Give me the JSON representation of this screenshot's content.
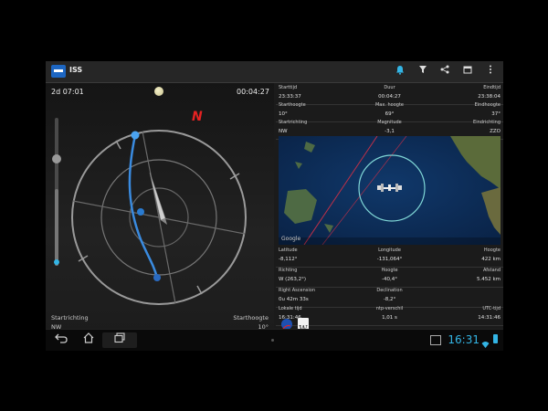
{
  "app": {
    "title": "ISS"
  },
  "actionbar": {
    "icons": [
      "bell-icon",
      "filter-icon",
      "share-icon",
      "calendar-icon",
      "overflow-menu-icon"
    ]
  },
  "left": {
    "countdown": "2d 07:01",
    "duration": "00:04:27",
    "compass_letter": "N",
    "start_dir_label": "Startrichting",
    "start_dir_value": "NW",
    "start_height_label": "Starthoogte",
    "start_height_value": "10°"
  },
  "details": {
    "row1": {
      "l1": "Starttijd",
      "v1": "23:33:37",
      "l2": "Duur",
      "v2": "00:04:27",
      "l3": "Eindtijd",
      "v3": "23:38:04"
    },
    "row2": {
      "l1": "Starthoogte",
      "v1": "10°",
      "l2": "Max. hoogte",
      "v2": "69°",
      "l3": "Eindhoogte",
      "v3": "37°"
    },
    "row3": {
      "l1": "Startrichting",
      "v1": "NW",
      "l2": "Magnitude",
      "v2": "-3,1",
      "l3": "Eindrichting",
      "v3": "ZZO"
    },
    "row4": {
      "l1": "Latitude",
      "v1": "-8,112°",
      "l2": "Longitude",
      "v2": "-131,064°",
      "l3": "Hoogte",
      "v3": "422 km"
    },
    "row5": {
      "l1": "Richting",
      "v1": "W (263,2°)",
      "l2": "Hoogte",
      "v2": "-40,4°",
      "l3": "Afstand",
      "v3": "5.452 km"
    },
    "row6": {
      "l1": "Right Ascension",
      "v1": "0u 42m 33s",
      "l2": "Declination",
      "v2": "-8,2°"
    },
    "row7": {
      "l1": "Lokale tijd",
      "v1": "16:31:46",
      "l2": "ntp-verschil",
      "v2": "1,01 s",
      "l3": "UTC-tijd",
      "v3": "14:31:46"
    }
  },
  "map": {
    "google": "Google"
  },
  "links": {
    "wiki": "W"
  },
  "statusbar": {
    "time": "16:31"
  },
  "colors": {
    "accent": "#33b5e5",
    "track": "#3a8be0",
    "north": "#e52222",
    "footprint": "#7fd6d6"
  }
}
